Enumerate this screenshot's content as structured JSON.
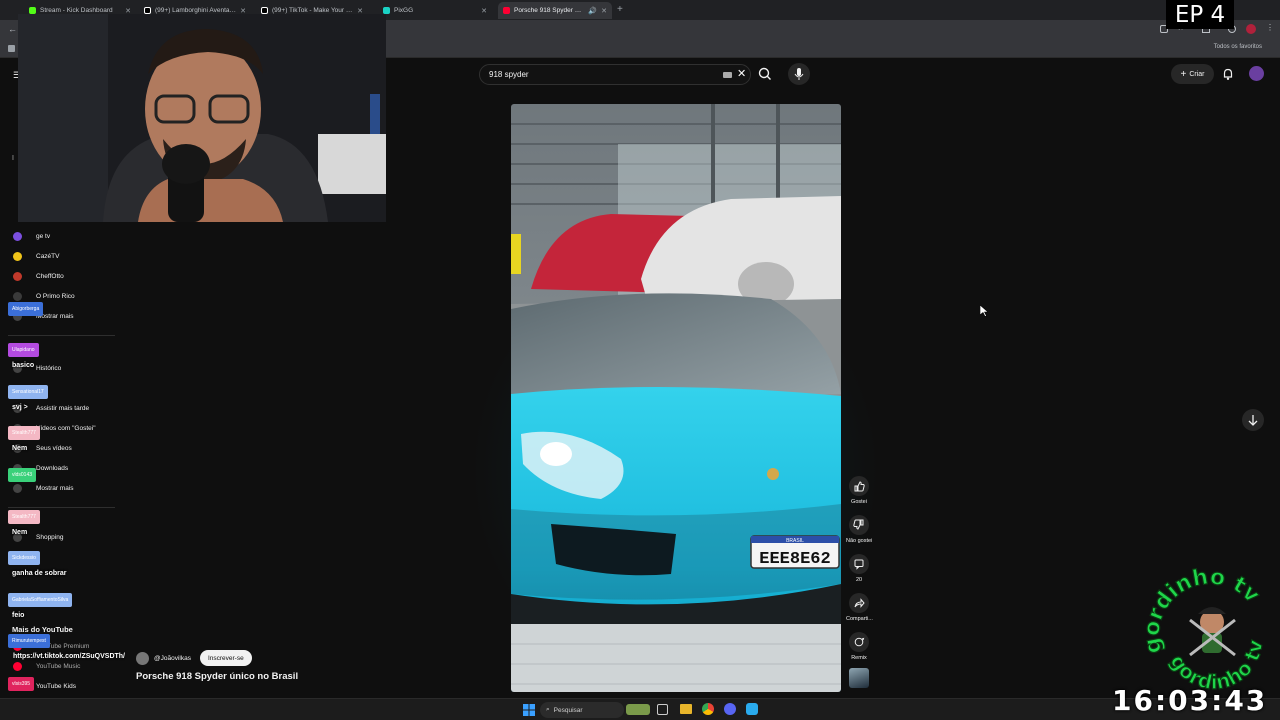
{
  "browser": {
    "tabs": [
      {
        "label": "Stream - Kick Dashboard",
        "color": "#53fc18",
        "active": false
      },
      {
        "label": "(99+) Lamborghini Aventador S",
        "color": "#000000",
        "active": false
      },
      {
        "label": "(99+) TikTok - Make Your Day",
        "color": "#000000",
        "active": false
      },
      {
        "label": "PixGG",
        "color": "#1ad2c4",
        "active": false
      },
      {
        "label": "Porsche 918 Spyder único n",
        "color": "#ff0033",
        "active": true
      }
    ],
    "bookmarks_all": "Todos os favoritos"
  },
  "episode_badge": "EP 4",
  "youtube": {
    "search_value": "918 spyder",
    "create_label": "Criar"
  },
  "sidebar": {
    "items": [
      {
        "label": "ge tv",
        "color": "#7b4fe0"
      },
      {
        "label": "CazéTV",
        "color": "#f0c419"
      },
      {
        "label": "CheffOtto",
        "color": "#c0392b"
      },
      {
        "label": "O Primo Rico",
        "color": "#3a3a3a"
      },
      {
        "label": "Mostrar mais",
        "color": "#444444"
      },
      {
        "label": "Histórico",
        "color": "#444444"
      },
      {
        "label": "Assistir mais tarde",
        "color": "#444444"
      },
      {
        "label": "Vídeos com \"Gostei\"",
        "color": "#444444"
      },
      {
        "label": "Seus vídeos",
        "color": "#444444"
      },
      {
        "label": "Downloads",
        "color": "#444444"
      },
      {
        "label": "Mostrar mais",
        "color": "#444444"
      },
      {
        "label": "Shopping",
        "color": "#444444"
      },
      {
        "label": "Mais do YouTube",
        "color": "#444444"
      },
      {
        "label": "YouTube Premium",
        "color": "#ff0033"
      },
      {
        "label": "YouTube Music",
        "color": "#ff0033"
      },
      {
        "label": "YouTube Kids",
        "color": "#ff0033"
      }
    ]
  },
  "chat": {
    "names": [
      {
        "name": "Abigorberga",
        "color": "#3b6fd8"
      },
      {
        "name": "Ulapidano",
        "color": "#b44be0"
      },
      {
        "name": "Sensational17",
        "color": "#8fb4f0"
      },
      {
        "name": "Stealth777",
        "color": "#f4b8c4"
      },
      {
        "name": "vlds0143",
        "color": "#3ad17a"
      },
      {
        "name": "Stealth777",
        "color": "#f4b8c4"
      },
      {
        "name": "Sickdessio",
        "color": "#8fb4f0"
      },
      {
        "name": "GabrielaSoffiamentoSilva",
        "color": "#8fb4f0"
      },
      {
        "name": "Rimurutempest",
        "color": "#3b6fd8"
      },
      {
        "name": "vlsis395",
        "color": "#e0245e"
      }
    ],
    "messages": [
      "basico",
      "svj >",
      "Nem",
      "Nem",
      "ganha de sobrar",
      "feio"
    ],
    "link": "https://vt.tiktok.com/ZSuQVSDTh/"
  },
  "video": {
    "channel": "@Joãovilkas",
    "subscribe_label": "Inscrever-se",
    "title": "Porsche 918 Spyder único no Brasil",
    "plate_country": "BRASIL",
    "plate": "EEE8E62"
  },
  "actions": {
    "like": "Gostei",
    "dislike": "Não gostei",
    "comments": "20",
    "share": "Comparti...",
    "remix": "Remix"
  },
  "taskbar": {
    "search_label": "Pesquisar"
  },
  "clock": "16:03:43",
  "logo": {
    "text_top": "gordinho tv",
    "text_bottom": "gordinho tv"
  }
}
